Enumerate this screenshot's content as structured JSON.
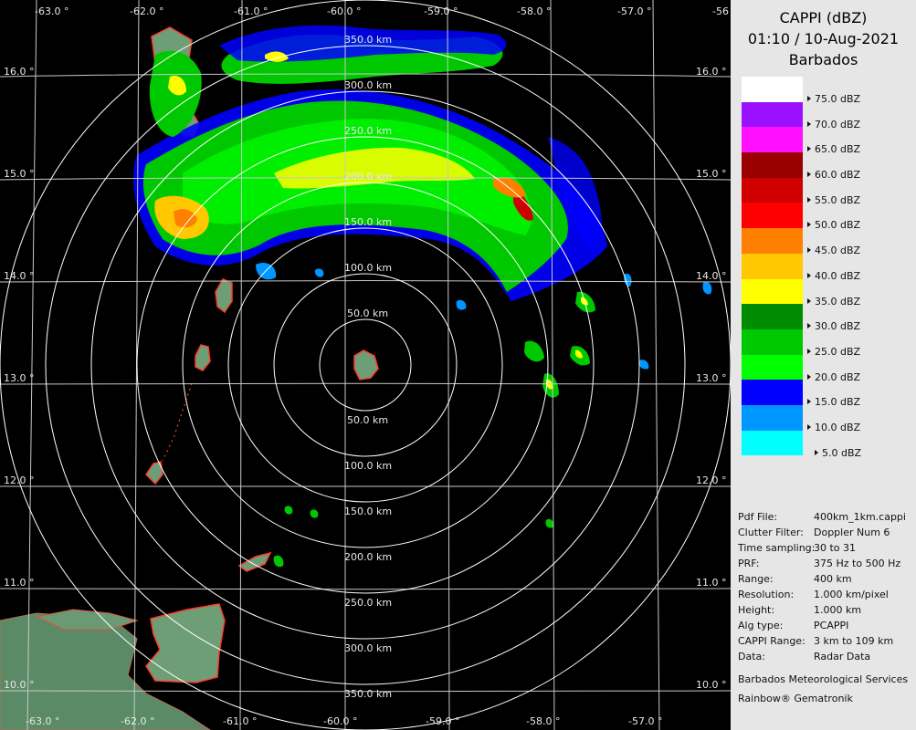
{
  "header": {
    "product": "CAPPI (dBZ)",
    "datetime": "01:10 / 10-Aug-2021",
    "station": "Barbados"
  },
  "legend": [
    {
      "label": "75.0 dBZ",
      "color": "#ffffff"
    },
    {
      "label": "70.0 dBZ",
      "color": "#9b10ff"
    },
    {
      "label": "65.0 dBZ",
      "color": "#ff10ff"
    },
    {
      "label": "60.0 dBZ",
      "color": "#9a0000"
    },
    {
      "label": "55.0 dBZ",
      "color": "#d00000"
    },
    {
      "label": "50.0 dBZ",
      "color": "#ff0000"
    },
    {
      "label": "45.0 dBZ",
      "color": "#ff7f00"
    },
    {
      "label": "40.0 dBZ",
      "color": "#ffc800"
    },
    {
      "label": "35.0 dBZ",
      "color": "#ffff00"
    },
    {
      "label": "30.0 dBZ",
      "color": "#008c00"
    },
    {
      "label": "25.0 dBZ",
      "color": "#00c800"
    },
    {
      "label": "20.0 dBZ",
      "color": "#00ff00"
    },
    {
      "label": "15.0 dBZ",
      "color": "#0000ff"
    },
    {
      "label": "10.0 dBZ",
      "color": "#0096ff"
    },
    {
      "label": "5.0 dBZ",
      "color": "#00ffff"
    }
  ],
  "metadata": [
    {
      "key": "Pdf File:",
      "value": "400km_1km.cappi"
    },
    {
      "key": "Clutter Filter:",
      "value": "Doppler Num 6"
    },
    {
      "key": "Time sampling:",
      "value": "30 to 31"
    },
    {
      "key": "PRF:",
      "value": "375 Hz to 500 Hz"
    },
    {
      "key": "Range:",
      "value": "400 km"
    },
    {
      "key": "Resolution:",
      "value": "1.000 km/pixel"
    },
    {
      "key": "Height:",
      "value": "1.000 km"
    },
    {
      "key": "Alg type:",
      "value": "PCAPPI"
    },
    {
      "key": "CAPPI Range:",
      "value": "3 km to 109 km"
    },
    {
      "key": "Data:",
      "value": "Radar Data"
    }
  ],
  "footer": {
    "organization": "Barbados Meteorological Services",
    "software": "Rainbow® Gematronik"
  },
  "range_rings": {
    "upper_labels": [
      "50.0 km",
      "100.0 km",
      "150.0 km",
      "200.0 km",
      "250.0 km",
      "300.0 km",
      "350.0 km"
    ],
    "lower_labels": [
      "50.0 km",
      "100.0 km",
      "150.0 km",
      "200.0 km",
      "250.0 km",
      "300.0 km",
      "350.0 km"
    ]
  },
  "longitude_labels_top": [
    "-63.0 °",
    "-62.0 °",
    "-61.0 °",
    "-60.0 °",
    "-59.0 °",
    "-58.0 °",
    "-57.0 °",
    "-56"
  ],
  "longitude_labels_bottom": [
    "-63.0 °",
    "-62.0 °",
    "-61.0 °",
    "-60.0 °",
    "-59.0 °",
    "-58.0 °",
    "-57.0 °"
  ],
  "latitude_labels_left": [
    "16.0 °",
    "15.0 °",
    "14.0 °",
    "13.0 °",
    "12.0 °",
    "11.0 °",
    "10.0 °"
  ],
  "latitude_labels_right": [
    "16.0 °",
    "15.0 °",
    "14.0 °",
    "13.0 °",
    "12.0 °",
    "11.0 °",
    "10.0 °"
  ],
  "colors": {
    "grid": "#c8c8c8",
    "ring": "#ffffff",
    "land": "#5f8f6e",
    "coast": "#ff3b2f",
    "panel_bg": "#e6e6e6"
  }
}
